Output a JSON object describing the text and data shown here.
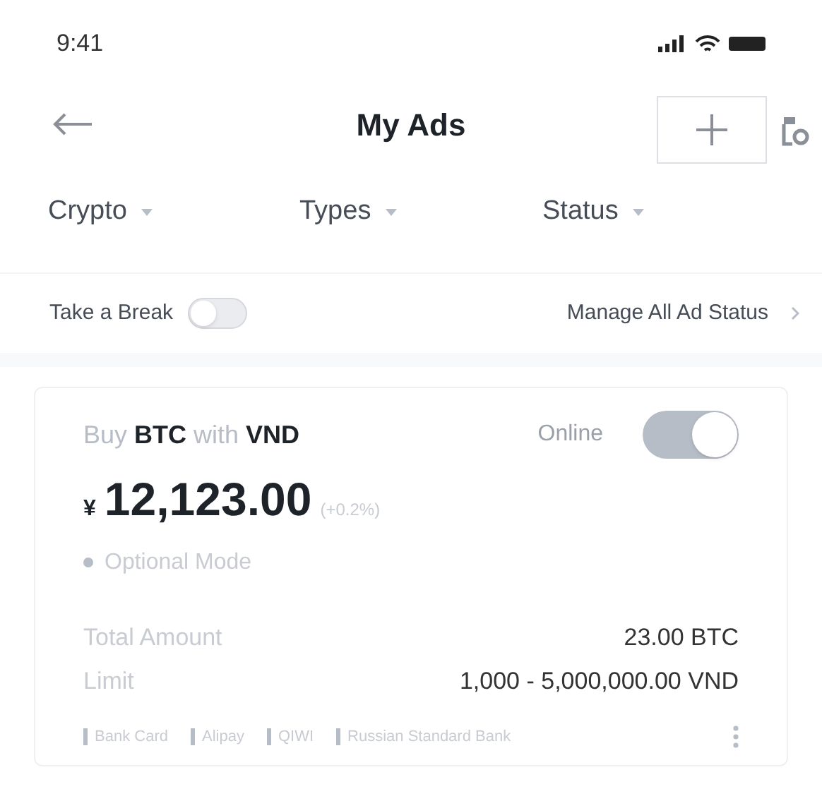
{
  "status_bar": {
    "time": "9:41"
  },
  "header": {
    "title": "My Ads"
  },
  "filters": [
    {
      "label": "Crypto"
    },
    {
      "label": "Types"
    },
    {
      "label": "Status"
    }
  ],
  "take_a_break": {
    "label": "Take a Break",
    "on": false
  },
  "manage_link": {
    "label": "Manage All Ad Status"
  },
  "ad": {
    "title": "Buy **BTC** with **VND**",
    "status_label": "Online",
    "online": true,
    "currency_symbol": "¥",
    "price": "12,123.00",
    "change": "(+0.2%)",
    "mode": "Optional Mode",
    "details": [
      {
        "label": "Total Amount",
        "value": "23.00 BTC"
      },
      {
        "label": "Limit",
        "value": "1,000 - 5,000,000.00 VND"
      }
    ],
    "payment_methods": [
      "Bank Card",
      "Alipay",
      "QIWI",
      "Russian Standard Bank"
    ]
  }
}
